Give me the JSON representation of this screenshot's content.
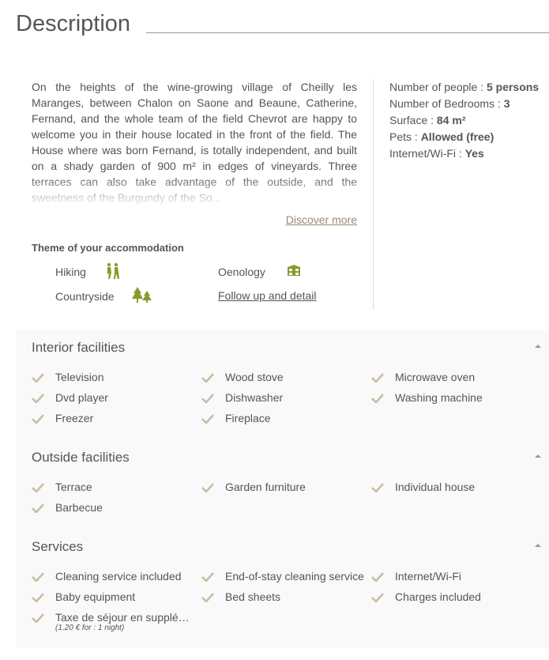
{
  "header": {
    "title": "Description"
  },
  "description": {
    "text": "On the heights of the wine-growing village of Cheilly les Maranges, between Chalon on Saone and Beaune, Catherine, Fernand, and the whole team of the field Chevrot are happy to welcome you in their house located in the front of the field. The House where was born Fernand, is totally independent, and built on a shady garden of 900 m² in edges of vineyards. Three terraces can also take advantage of the outside, and the sweetness of the Burgundy of the So...",
    "discover_label": "Discover more"
  },
  "themes": {
    "title": "Theme of your accommodation",
    "items": [
      {
        "label": "Hiking",
        "icon": "hiking-icon"
      },
      {
        "label": "Oenology",
        "icon": "wine-cellar-icon"
      },
      {
        "label": "Countryside",
        "icon": "trees-icon"
      }
    ],
    "follow_label": "Follow up and detail",
    "icon_color": "#8a9a2a"
  },
  "facts": [
    {
      "label": "Number of people : ",
      "value": "5 persons"
    },
    {
      "label": "Number of Bedrooms : ",
      "value": "3"
    },
    {
      "label": "Surface : ",
      "value": "84 m²"
    },
    {
      "label": "Pets : ",
      "value": "Allowed (free)"
    },
    {
      "label": "Internet/Wi-Fi : ",
      "value": "Yes"
    }
  ],
  "interior": {
    "title": "Interior facilities",
    "items": [
      "Television",
      "Wood stove",
      "Microwave oven",
      "Dvd player",
      "Dishwasher",
      "Washing machine",
      "Freezer",
      "Fireplace"
    ]
  },
  "outside": {
    "title": "Outside facilities",
    "items": [
      "Terrace",
      "Garden furniture",
      "Individual house",
      "Barbecue"
    ]
  },
  "services": {
    "title": "Services",
    "items": [
      "Cleaning service included",
      "End-of-stay cleaning service",
      "Internet/Wi-Fi",
      "Baby equipment",
      "Bed sheets",
      "Charges included",
      "Taxe de séjour en supplé…"
    ],
    "tax_note": "(1.20 € for : 1 night)"
  },
  "colors": {
    "check": "#c9bda3",
    "accent_link": "#9a8a6e",
    "section_bg": "#f9f9f9"
  }
}
